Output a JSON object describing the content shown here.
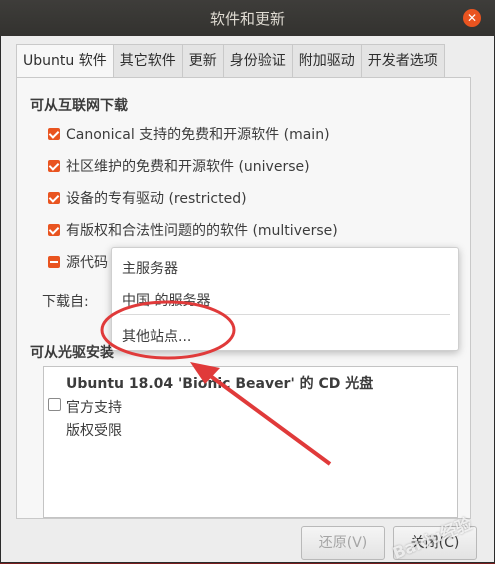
{
  "window": {
    "title": "软件和更新",
    "close_icon": "close-icon"
  },
  "tabs": [
    "Ubuntu 软件",
    "其它软件",
    "更新",
    "身份验证",
    "附加驱动",
    "开发者选项"
  ],
  "downloadable": {
    "title": "可从互联网下载",
    "items": [
      {
        "label": "Canonical 支持的免费和开源软件 (main)",
        "state": "checked"
      },
      {
        "label": "社区维护的免费和开源软件 (universe)",
        "state": "checked"
      },
      {
        "label": "设备的专有驱动 (restricted)",
        "state": "checked"
      },
      {
        "label": "有版权和合法性问题的的软件 (multiverse)",
        "state": "checked"
      },
      {
        "label": "源代码",
        "state": "mixed"
      }
    ],
    "download_from_label": "下载自:"
  },
  "dropdown_menu": {
    "items": [
      "主服务器",
      "中国 的服务器",
      "其他站点..."
    ]
  },
  "cdrom": {
    "title": "可从光驱安装",
    "entry_title": "Ubuntu 18.04 'Bionic Beaver' 的 CD 光盘",
    "entry_lines": [
      "官方支持",
      "版权受限"
    ]
  },
  "buttons": {
    "revert": "还原(V)",
    "close": "关闭(C)"
  },
  "watermark": "Baidu经验",
  "colors": {
    "accent": "#e95420",
    "annotation": "#e03a3a"
  }
}
